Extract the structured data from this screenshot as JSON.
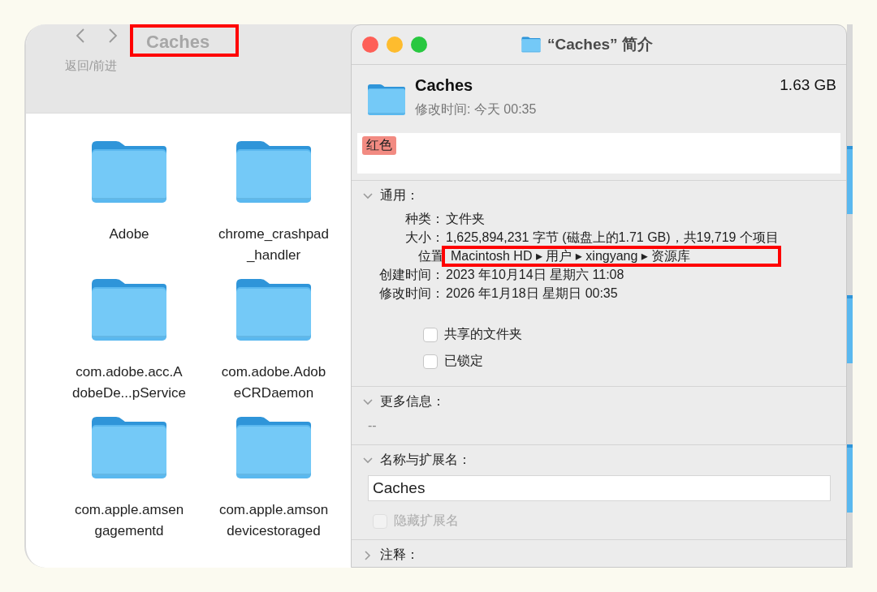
{
  "finder": {
    "title": "Caches",
    "title_annotated": true,
    "nav_hint": "返回/前进",
    "items": [
      {
        "lines": [
          "Adobe"
        ]
      },
      {
        "lines": [
          "chrome_crashpad",
          "_handler"
        ]
      },
      {
        "lines": [
          "com.adobe.acc.A",
          "dobeDe...pService"
        ]
      },
      {
        "lines": [
          "com.adobe.Adob",
          "eCRDaemon"
        ]
      },
      {
        "lines": [
          "com.apple.amsen",
          "gagementd"
        ]
      },
      {
        "lines": [
          "com.apple.amson",
          "devicestoraged"
        ]
      }
    ]
  },
  "info_window": {
    "title": "“Caches” 简介",
    "name": "Caches",
    "size": "1.63 GB",
    "modified": "修改时间: 今天 00:35",
    "tags": [
      {
        "label": "红色",
        "color": "#f28b82"
      }
    ],
    "sections": [
      {
        "kind": "general",
        "title": "通用：",
        "expanded": true,
        "rows": [
          {
            "label": "种类：",
            "value": "文件夹",
            "annotated": false
          },
          {
            "label": "大小：",
            "value": "1,625,894,231 字节 (磁盘上的1.71 GB)，共19,719 个项目",
            "annotated": false
          },
          {
            "label": "位置",
            "value": "Macintosh HD ▸ 用户 ▸ xingyang ▸ 资源库",
            "annotated": true
          },
          {
            "label": "创建时间：",
            "value": "2023 年10月14日 星期六 11:08",
            "annotated": false
          },
          {
            "label": "修改时间：",
            "value": "2026 年1月18日 星期日 00:35",
            "annotated": false
          }
        ],
        "checkboxes": [
          {
            "label": "共享的文件夹",
            "checked": false,
            "disabled": false
          },
          {
            "label": "已锁定",
            "checked": false,
            "disabled": false
          }
        ]
      },
      {
        "kind": "text",
        "title": "更多信息：",
        "expanded": true,
        "text": "--"
      },
      {
        "kind": "name",
        "title": "名称与扩展名：",
        "expanded": true,
        "value": "Caches",
        "checkboxes": [
          {
            "label": "隐藏扩展名",
            "checked": false,
            "disabled": true
          }
        ]
      },
      {
        "title": "注释：",
        "expanded": false
      }
    ]
  }
}
